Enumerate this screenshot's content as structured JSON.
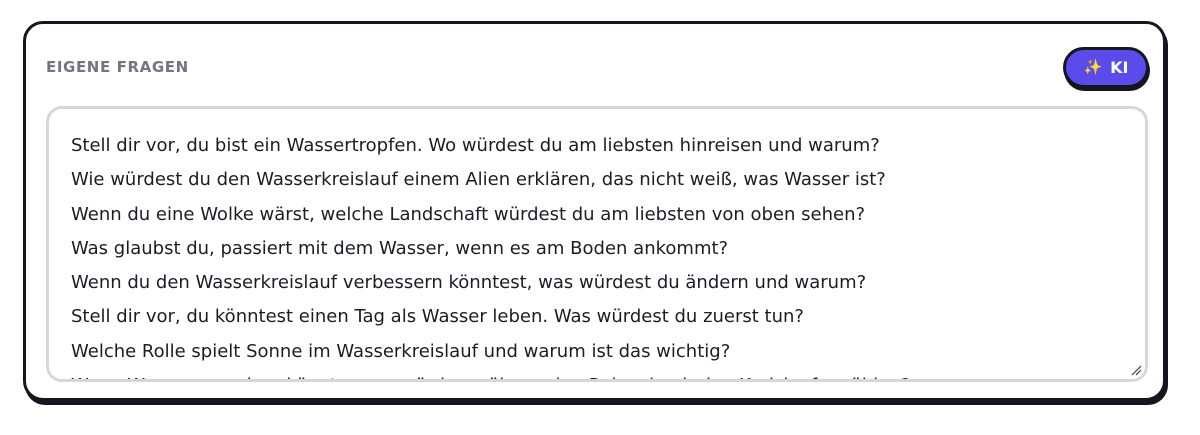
{
  "section": {
    "title": "EIGENE FRAGEN"
  },
  "ki_button": {
    "icon": "sparkles-icon",
    "glyph": "✨",
    "label": "KI"
  },
  "questions": [
    "Stell dir vor, du bist ein Wassertropfen. Wo würdest du am liebsten hinreisen und warum?",
    "Wie würdest du den Wasserkreislauf einem Alien erklären, das nicht weiß, was Wasser ist?",
    "Wenn du eine Wolke wärst, welche Landschaft würdest du am liebsten von oben sehen?",
    "Was glaubst du, passiert mit dem Wasser, wenn es am Boden ankommt?",
    "Wenn du den Wasserkreislauf verbessern könntest, was würdest du ändern und warum?",
    "Stell dir vor, du könntest einen Tag als Wasser leben. Was würdest du zuerst tun?",
    "Welche Rolle spielt Sonne im Wasserkreislauf und warum ist das wichtig?",
    "Wenn Wasser sprechen könnte, was würde es über seine Reise durch den Kreislauf erzählen?"
  ],
  "colors": {
    "accent": "#5a4bea",
    "border": "#15161f",
    "title_gray": "#737682",
    "textarea_border": "#d6d7dc"
  }
}
